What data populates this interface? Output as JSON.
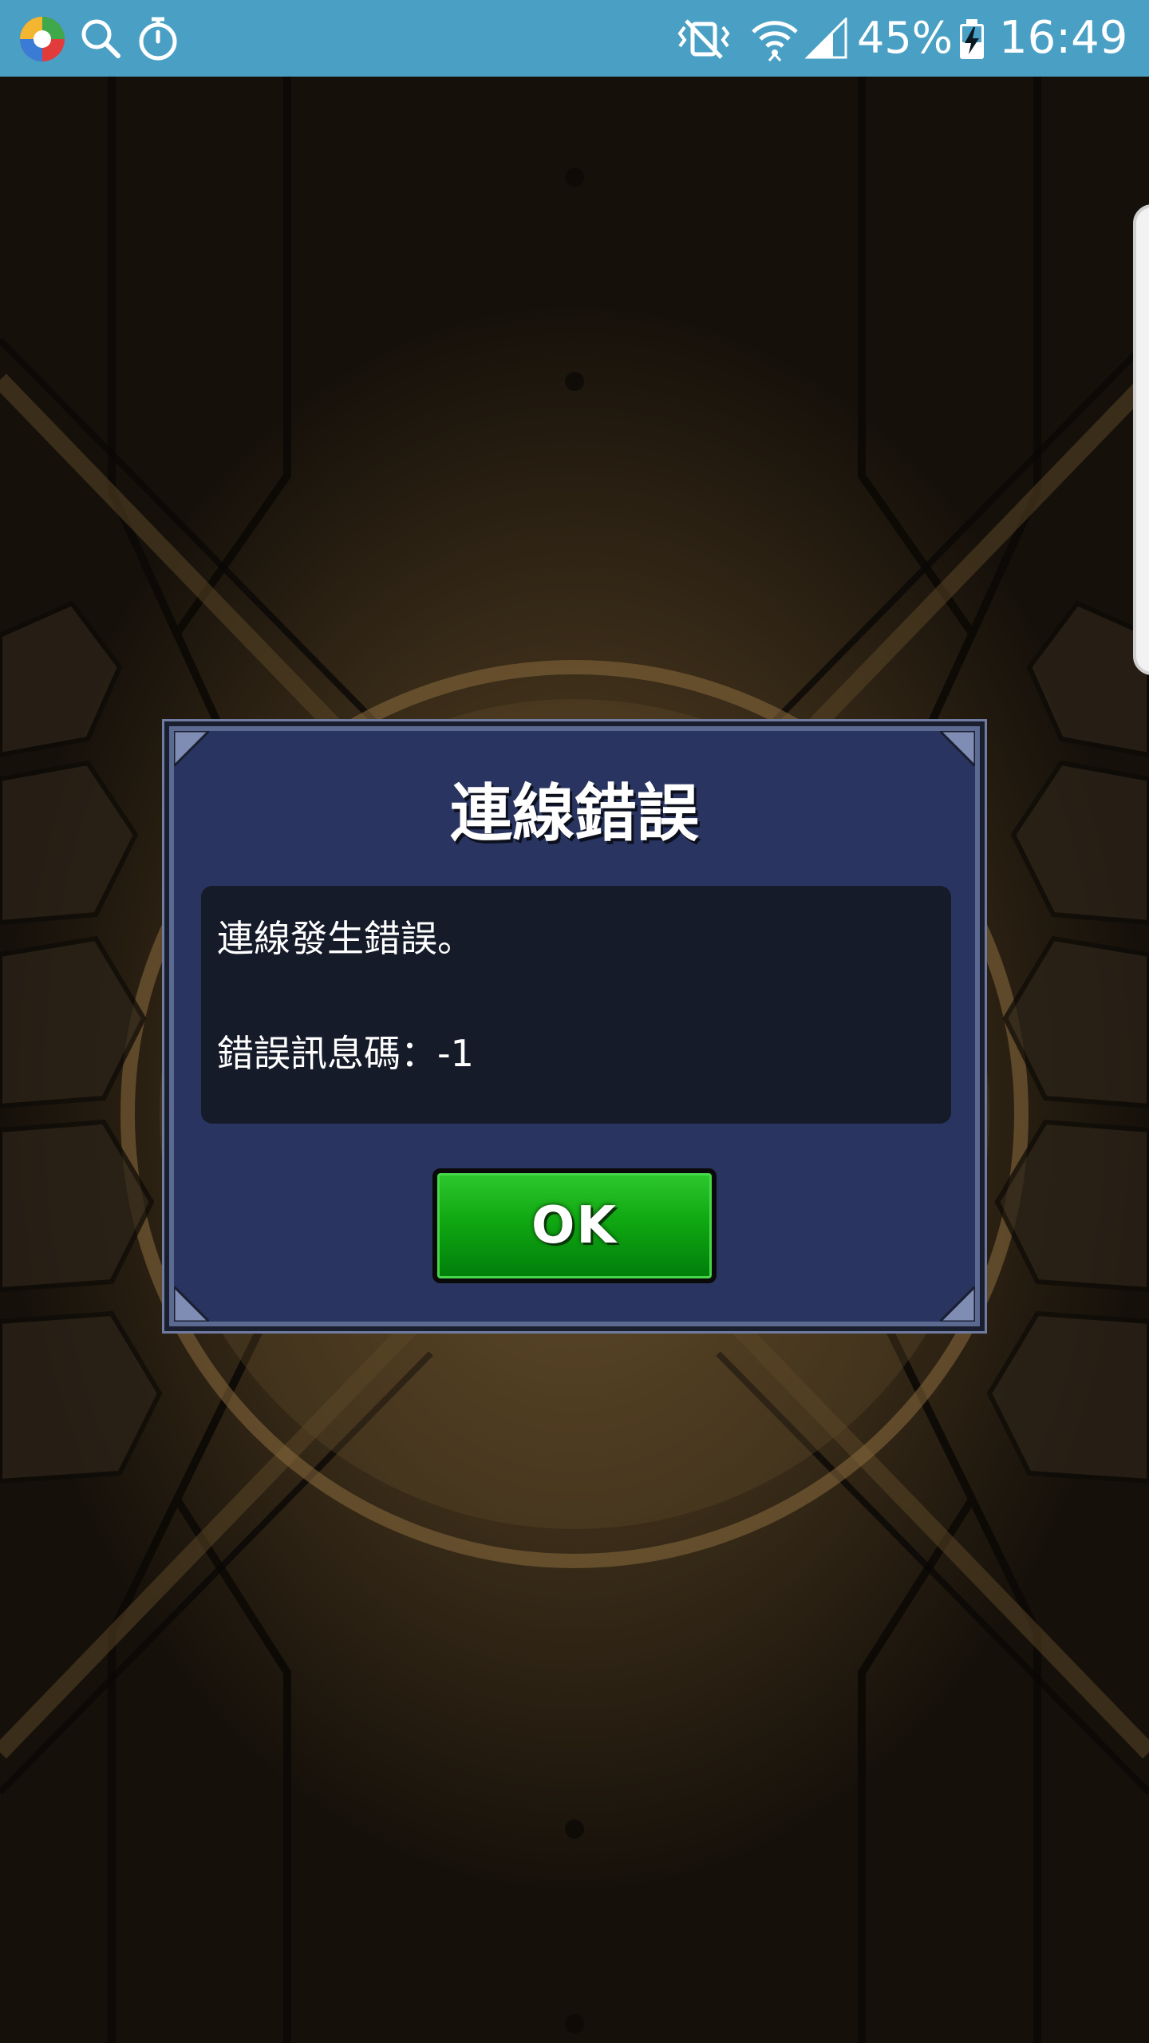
{
  "status_bar": {
    "battery_percent": "45%",
    "time": "16:49",
    "icons": [
      "app-icon",
      "search-icon",
      "timer-icon",
      "mute-vibrate-icon",
      "wifi-icon",
      "signal-icon",
      "battery-charging-icon"
    ],
    "background_color": "#4aa0c4"
  },
  "dialog": {
    "title": "連線錯誤",
    "message_line_1": "連線發生錯誤。",
    "message_line_2": "錯誤訊息碼：-1",
    "ok_label": "OK",
    "colors": {
      "panel": "#293560",
      "message_box": "#161b2a",
      "ok_button": "#10a812"
    }
  }
}
